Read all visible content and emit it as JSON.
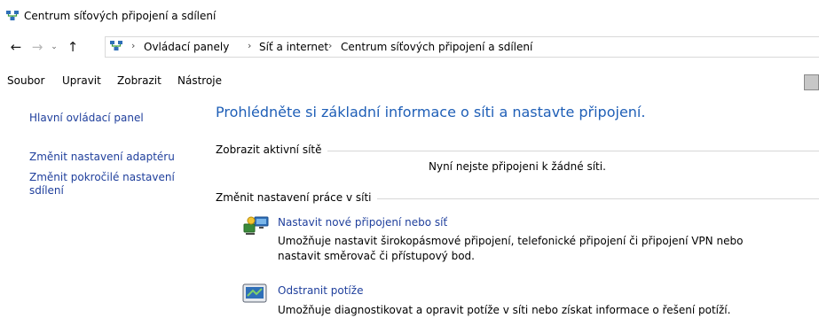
{
  "window": {
    "title": "Centrum síťových připojení a sdílení"
  },
  "nav": {
    "back_glyph": "←",
    "forward_glyph": "→",
    "history_glyph": "⌄",
    "up_glyph": "↑",
    "breadcrumb": [
      {
        "label": "Ovládací panely"
      },
      {
        "label": "Síť a internet"
      },
      {
        "label": "Centrum síťových připojení a sdílení"
      }
    ],
    "separator": "›"
  },
  "menu": {
    "items": [
      "Soubor",
      "Upravit",
      "Zobrazit",
      "Nástroje"
    ]
  },
  "sidebar": {
    "links": [
      {
        "label": "Hlavní ovládací panel"
      },
      {
        "label": "Změnit nastavení adaptéru"
      },
      {
        "label": "Změnit pokročilé nastavení sdílení"
      }
    ]
  },
  "main": {
    "heading": "Prohlédněte si základní informace o síti a nastavte připojení.",
    "active_networks": {
      "label": "Zobrazit aktivní sítě",
      "status": "Nyní nejste připojeni k žádné síti."
    },
    "change_settings": {
      "label": "Změnit nastavení práce v síti",
      "tasks": [
        {
          "title": "Nastavit nové připojení nebo síť",
          "description": "Umožňuje nastavit širokopásmové připojení, telefonické připojení či připojení VPN nebo nastavit směrovač či přístupový bod.",
          "icon": "network-setup-icon"
        },
        {
          "title": "Odstranit potíže",
          "description": "Umožňuje diagnostikovat a opravit potíže v síti nebo získat informace o řešení potíží.",
          "icon": "troubleshoot-icon"
        }
      ]
    }
  },
  "colors": {
    "link": "#1f3f9c",
    "heading": "#1f5fb7",
    "rule": "#d7d7d7"
  }
}
